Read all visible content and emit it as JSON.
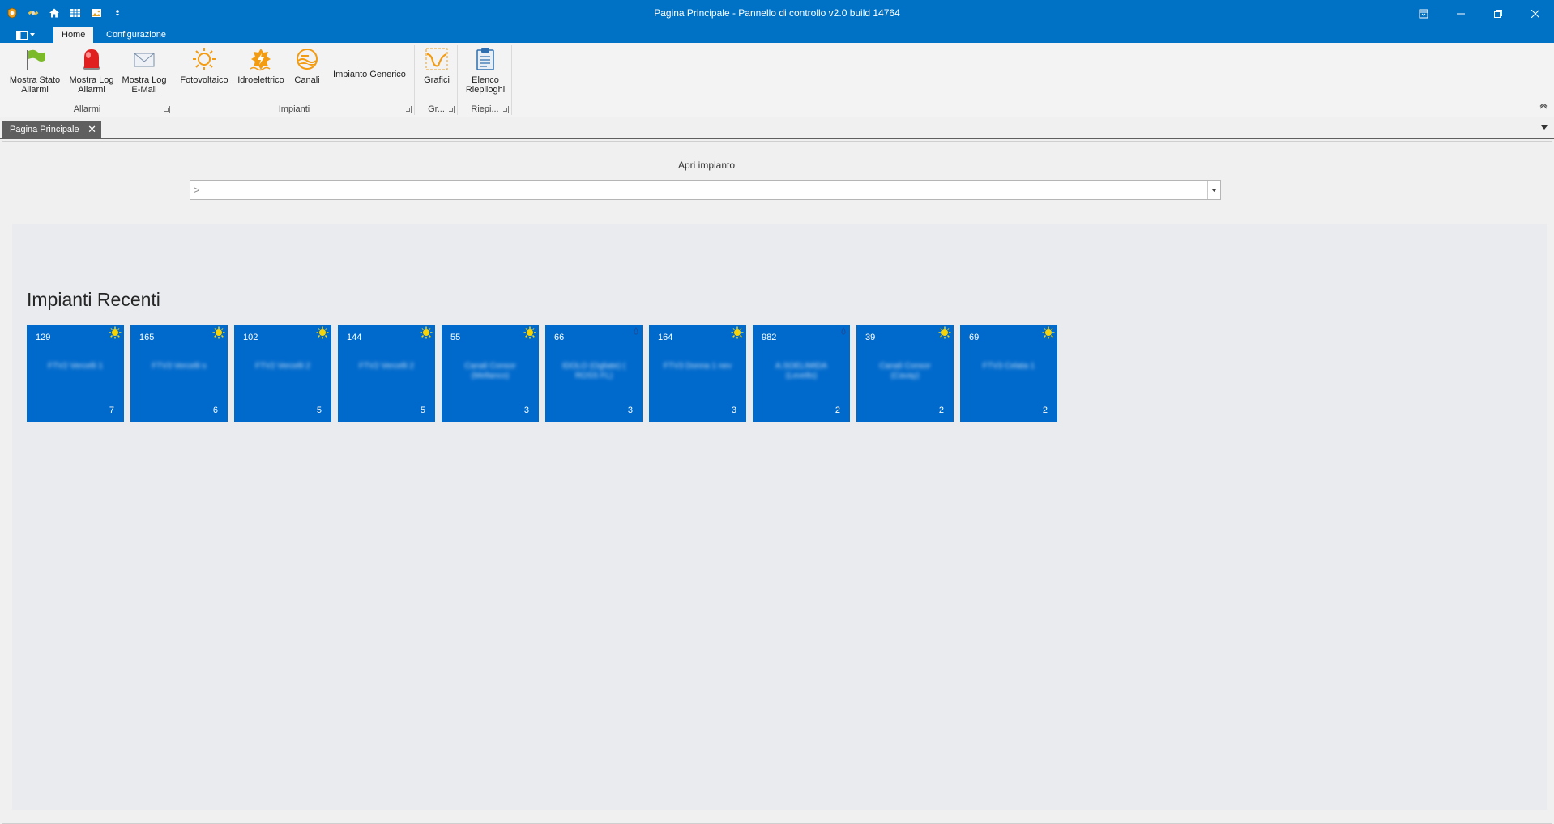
{
  "window": {
    "title": "Pagina Principale - Pannello di controllo v2.0 build 14764",
    "controls": [
      "restore-dock",
      "minimize",
      "restore",
      "close"
    ]
  },
  "quick_access": [
    "app-logo-icon",
    "satellite-icon",
    "home-icon",
    "table-icon",
    "image-icon",
    "customize-qat-icon"
  ],
  "ribbon": {
    "tabs": [
      {
        "label": "Home",
        "active": true
      },
      {
        "label": "Configurazione",
        "active": false
      }
    ],
    "groups": [
      {
        "label": "Allarmi",
        "buttons": [
          {
            "label1": "Mostra Stato",
            "label2": "Allarmi",
            "icon": "flag-icon"
          },
          {
            "label1": "Mostra Log",
            "label2": "Allarmi",
            "icon": "alarm-siren-icon"
          },
          {
            "label1": "Mostra Log",
            "label2": "E-Mail",
            "icon": "envelope-icon"
          }
        ]
      },
      {
        "label": "Impianti",
        "buttons": [
          {
            "label1": "Fotovoltaico",
            "label2": "",
            "icon": "sun-icon"
          },
          {
            "label1": "Idroelettrico",
            "label2": "",
            "icon": "hydro-icon"
          },
          {
            "label1": "Canali",
            "label2": "",
            "icon": "channel-icon"
          },
          {
            "label1": "Impianto Generico",
            "label2": "",
            "icon": ""
          }
        ]
      },
      {
        "label": "Gr...",
        "buttons": [
          {
            "label1": "Grafici",
            "label2": "",
            "icon": "chart-icon"
          }
        ]
      },
      {
        "label": "Riepi...",
        "buttons": [
          {
            "label1": "Elenco",
            "label2": "Riepiloghi",
            "icon": "clipboard-icon"
          }
        ]
      }
    ]
  },
  "doc_tabs": [
    {
      "label": "Pagina Principale",
      "close": "✕"
    }
  ],
  "open_plant": {
    "label": "Apri impianto",
    "prefix": ">",
    "value": ""
  },
  "recent": {
    "title": "Impianti Recenti",
    "tiles": [
      {
        "id": "129",
        "name": "FTV2 Vercelli 1",
        "count": "7",
        "icon": "sun"
      },
      {
        "id": "165",
        "name": "FTV3 Vercelli s",
        "count": "6",
        "icon": "sun"
      },
      {
        "id": "102",
        "name": "FTV2 Vercelli 2",
        "count": "5",
        "icon": "sun"
      },
      {
        "id": "144",
        "name": "FTV2 Vercelli 2",
        "count": "5",
        "icon": "sun"
      },
      {
        "id": "55",
        "name": "Canali Consor (Mellanco)",
        "count": "3",
        "icon": "sun"
      },
      {
        "id": "66",
        "name": "IDOLO (Ogliate) ( ROSS FL)",
        "count": "3",
        "icon": "drop"
      },
      {
        "id": "164",
        "name": "FTV3 Donna 1 nev",
        "count": "3",
        "icon": "sun"
      },
      {
        "id": "982",
        "name": "A.SOELIMIDA (Levello)",
        "count": "2",
        "icon": "drop"
      },
      {
        "id": "39",
        "name": "Canali Consor (Cavay)",
        "count": "2",
        "icon": "sun"
      },
      {
        "id": "69",
        "name": "FTV3 Celata 1",
        "count": "2",
        "icon": "sun"
      }
    ]
  },
  "colors": {
    "titlebar": "#0072c6",
    "tile": "#006acc",
    "sun": "#f7d40a",
    "accent_orange": "#f39c12"
  }
}
